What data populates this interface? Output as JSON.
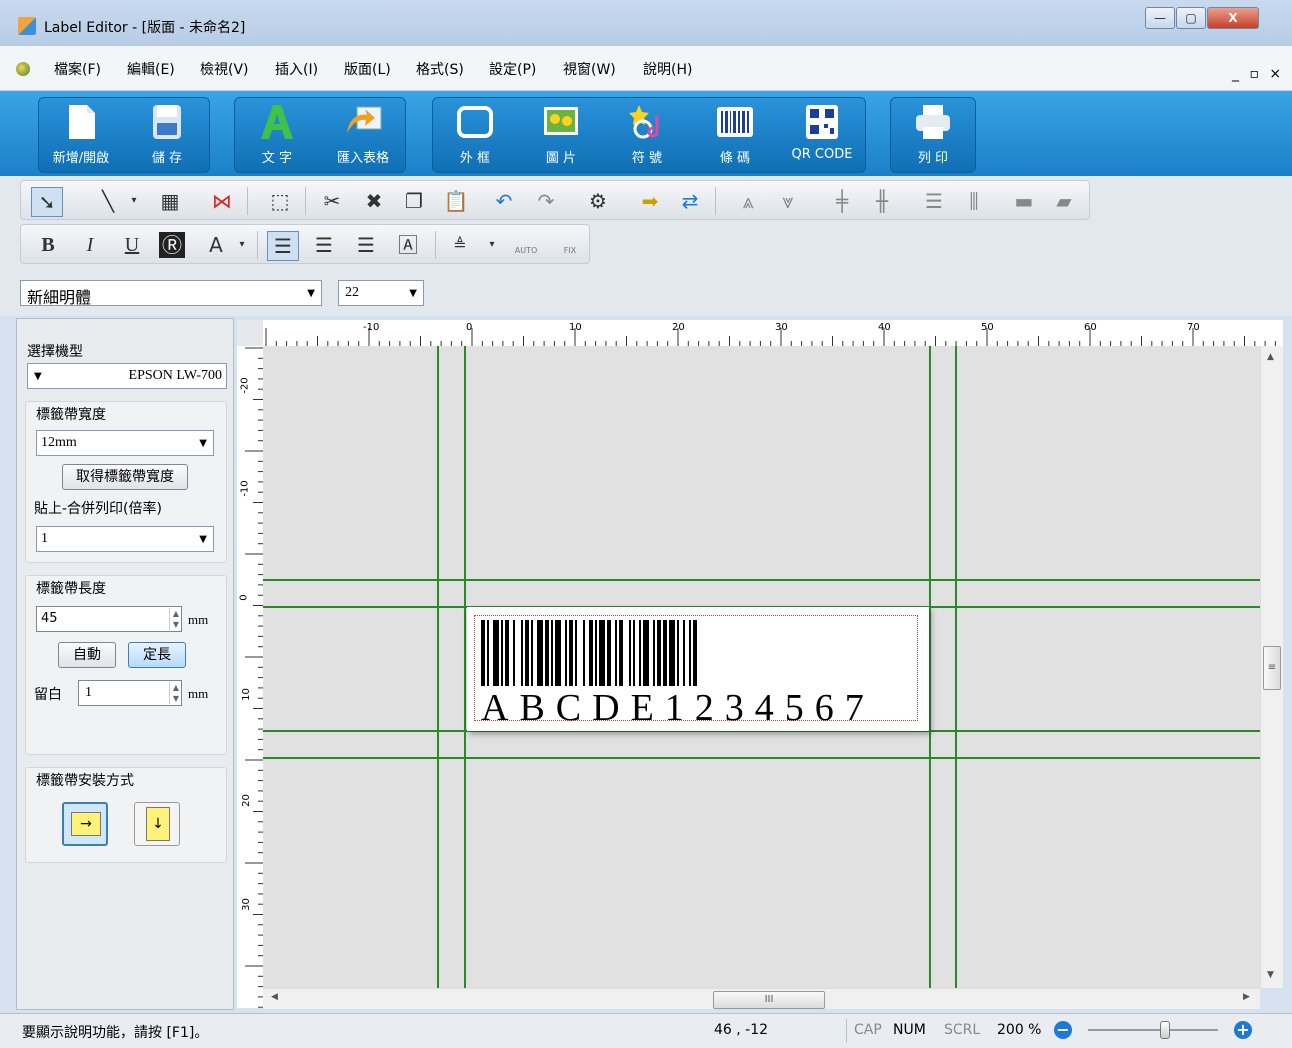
{
  "window": {
    "title": "Label Editor - [版面 - 未命名2]",
    "min_glyph": "—",
    "max_glyph": "▢",
    "close_glyph": "X"
  },
  "menu": {
    "items": [
      "檔案(F)",
      "編輯(E)",
      "檢視(V)",
      "插入(I)",
      "版面(L)",
      "格式(S)",
      "設定(P)",
      "視窗(W)",
      "說明(H)"
    ],
    "mdi_controls": "_ ▫ ×"
  },
  "ribbon": {
    "buttons": [
      {
        "label": "新增/開啟",
        "icon": "new-document-icon"
      },
      {
        "label": "儲 存",
        "icon": "save-icon"
      },
      {
        "label": "文 字",
        "icon": "text-icon"
      },
      {
        "label": "匯入表格",
        "icon": "import-table-icon"
      },
      {
        "label": "外 框",
        "icon": "frame-icon"
      },
      {
        "label": "圖 片",
        "icon": "picture-icon"
      },
      {
        "label": "符 號",
        "icon": "symbol-icon"
      },
      {
        "label": "條 碼",
        "icon": "barcode-icon"
      },
      {
        "label": "QR CODE",
        "icon": "qr-code-icon"
      },
      {
        "label": "列 印",
        "icon": "print-icon"
      }
    ]
  },
  "format_toolbar": {
    "bold": "B",
    "italic": "I",
    "underline": "U",
    "font_color": "A",
    "auto": "AUTO",
    "fix": "FIX"
  },
  "font": {
    "family": "新細明體",
    "size": "22"
  },
  "left_panel": {
    "model_label": "選擇機型",
    "model_value": "EPSON LW-700",
    "tape_width_group": "標籤帶寬度",
    "tape_width_value": "12mm",
    "get_width_button": "取得標籤帶寬度",
    "paste_merge_label": "貼上-合併列印(倍率)",
    "paste_merge_value": "1",
    "tape_length_group": "標籤帶長度",
    "tape_length_value": "45",
    "unit": "mm",
    "auto_button": "自動",
    "fixed_button": "定長",
    "margin_label": "留白",
    "margin_value": "1",
    "install_group": "標籤帶安裝方式"
  },
  "rulers": {
    "h_labels": [
      "-10",
      "0",
      "10",
      "20",
      "30",
      "40",
      "50",
      "60",
      "70"
    ],
    "v_labels": [
      "-20",
      "-10",
      "0",
      "10",
      "20",
      "30"
    ]
  },
  "label": {
    "barcode_text": "ABCDE1234567"
  },
  "scroll": {
    "h_thumb_glyph": "III",
    "v_thumb_glyph": "≡"
  },
  "status": {
    "help_text": "要顯示說明功能，請按 [F1]。",
    "coords": "46 , -12",
    "cap": "CAP",
    "num": "NUM",
    "scrl": "SCRL",
    "zoom": "200 %"
  },
  "colors": {
    "ribbon": "#1b80c8",
    "guide_lines": "#2a8a2a"
  }
}
